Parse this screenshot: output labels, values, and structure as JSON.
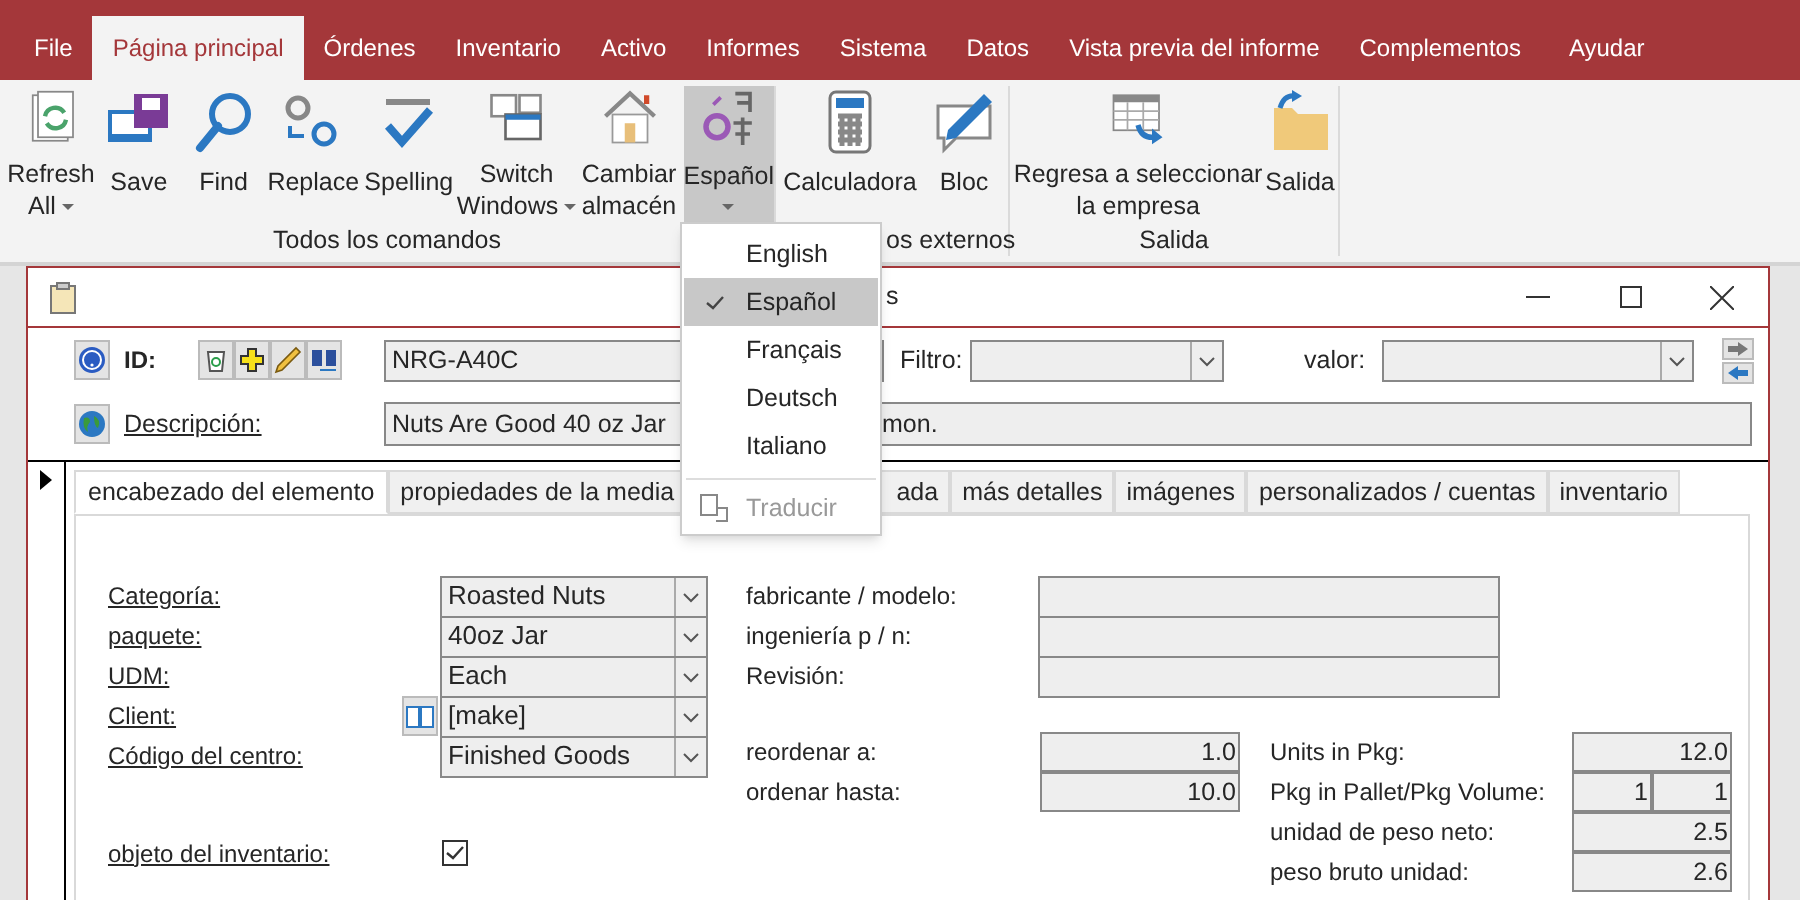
{
  "menu_tabs": [
    {
      "label": "File",
      "selected": false
    },
    {
      "label": "Página principal",
      "selected": true
    },
    {
      "label": "Órdenes",
      "selected": false
    },
    {
      "label": "Inventario",
      "selected": false
    },
    {
      "label": "Activo",
      "selected": false
    },
    {
      "label": "Informes",
      "selected": false
    },
    {
      "label": "Sistema",
      "selected": false
    },
    {
      "label": "Datos",
      "selected": false
    },
    {
      "label": "Vista previa del informe",
      "selected": false
    },
    {
      "label": "Complementos",
      "selected": false
    },
    {
      "label": "Ayudar",
      "selected": false
    }
  ],
  "ribbon": {
    "groups": [
      {
        "label": "Todos los comandos",
        "buttons": [
          {
            "label": "Refresh\nAll",
            "dropdown": true,
            "expanded": false
          },
          {
            "label": "Save",
            "dropdown": false,
            "expanded": false
          },
          {
            "label": "Find",
            "dropdown": false,
            "expanded": false
          },
          {
            "label": "Replace",
            "dropdown": false,
            "expanded": false
          },
          {
            "label": "Spelling",
            "dropdown": false,
            "expanded": false
          },
          {
            "label": "Switch\nWindows",
            "dropdown": true,
            "expanded": false
          },
          {
            "label": "Cambiar\nalmacén",
            "dropdown": false,
            "expanded": false
          },
          {
            "label": "Español",
            "dropdown": true,
            "expanded": true
          }
        ]
      },
      {
        "label": "os externos",
        "buttons": [
          {
            "label": "Calculadora",
            "dropdown": false,
            "expanded": false
          },
          {
            "label": "Bloc",
            "dropdown": false,
            "expanded": false
          }
        ]
      },
      {
        "label": "Salida",
        "buttons": [
          {
            "label": "Regresa a seleccionar\nla empresa",
            "dropdown": false,
            "expanded": false
          },
          {
            "label": "Salida",
            "dropdown": false,
            "expanded": false
          }
        ]
      }
    ]
  },
  "language_menu": [
    {
      "kind": "option",
      "label": "English",
      "checked": false,
      "selected": false
    },
    {
      "kind": "option",
      "label": "Español",
      "checked": true,
      "selected": true
    },
    {
      "kind": "option",
      "label": "Français",
      "checked": false,
      "selected": false
    },
    {
      "kind": "option",
      "label": "Deutsch",
      "checked": false,
      "selected": false
    },
    {
      "kind": "option",
      "label": "Italiano",
      "checked": false,
      "selected": false
    },
    {
      "kind": "command",
      "label": "Traducir",
      "disabled": true
    }
  ],
  "document_window": {
    "title": "s"
  },
  "header": {
    "id_label": "ID:",
    "id_value": "NRG-A40C",
    "filter_label": "Filtro:",
    "value_label": "valor:",
    "description_label": "Descripción:",
    "description_parts": [
      "Nuts Are Good 40 oz Jar",
      "mon."
    ]
  },
  "tabs": [
    {
      "label": "encabezado del elemento",
      "selected": true
    },
    {
      "label": "propiedades de la media",
      "selected": false
    },
    {
      "label": "ada",
      "selected": false
    },
    {
      "label": "más detalles",
      "selected": false
    },
    {
      "label": "imágenes",
      "selected": false
    },
    {
      "label": "personalizados / cuentas",
      "selected": false
    },
    {
      "label": "inventario",
      "selected": false
    }
  ],
  "item_fields": [
    {
      "label": "Categoría:",
      "value": "Roasted Nuts",
      "lookup": false
    },
    {
      "label": "paquete:",
      "value": "40oz Jar",
      "lookup": false
    },
    {
      "label": "UDM:",
      "value": "Each",
      "lookup": false
    },
    {
      "label": "Client:",
      "value": "[make]",
      "lookup": true
    },
    {
      "label": "Código del centro:",
      "value": "Finished Goods",
      "lookup": false
    }
  ],
  "inventory_item": {
    "label": "objeto del inventario:",
    "checked": true
  },
  "maker_fields": [
    {
      "label": "fabricante / modelo:"
    },
    {
      "label": "ingeniería p / n:"
    },
    {
      "label": "Revisión:"
    }
  ],
  "reorder_fields": [
    {
      "label": "reordenar a:",
      "value": "1.0"
    },
    {
      "label": "ordenar hasta:",
      "value": "10.0"
    }
  ],
  "package_fields": [
    {
      "label": "Units in Pkg:",
      "values": [
        "12.0"
      ]
    },
    {
      "label": "Pkg in Pallet/Pkg Volume:",
      "values": [
        "1",
        "1"
      ]
    },
    {
      "label": "unidad de peso neto:",
      "values": [
        "2.5"
      ]
    },
    {
      "label": "peso bruto unidad:",
      "values": [
        "2.6"
      ]
    }
  ]
}
